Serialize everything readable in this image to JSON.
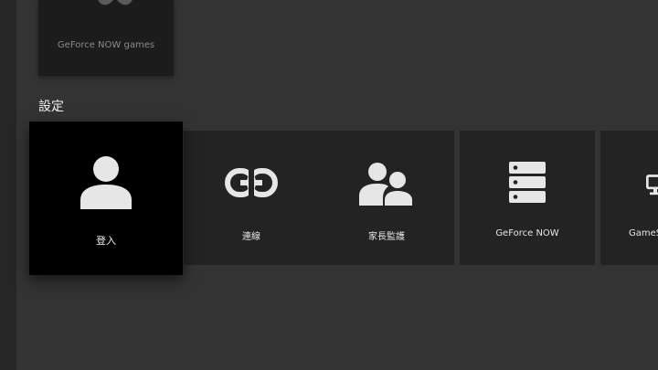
{
  "top_card": {
    "label": "GeForce NOW games",
    "icon": "gamepad-icon"
  },
  "settings": {
    "title": "設定",
    "tiles": [
      {
        "label": "登入",
        "icon": "person-icon",
        "focused": true
      },
      {
        "label": "連線",
        "icon": "link-icon"
      },
      {
        "label": "家長監護",
        "icon": "people-icon"
      },
      {
        "label": "GeForce NOW",
        "icon": "server-icon"
      },
      {
        "label": "GameS",
        "icon": "monitor-icon"
      }
    ]
  },
  "colors": {
    "background": "#333333",
    "tile": "#232323",
    "focused_tile": "#000000",
    "icon": "#e6e6e6"
  }
}
